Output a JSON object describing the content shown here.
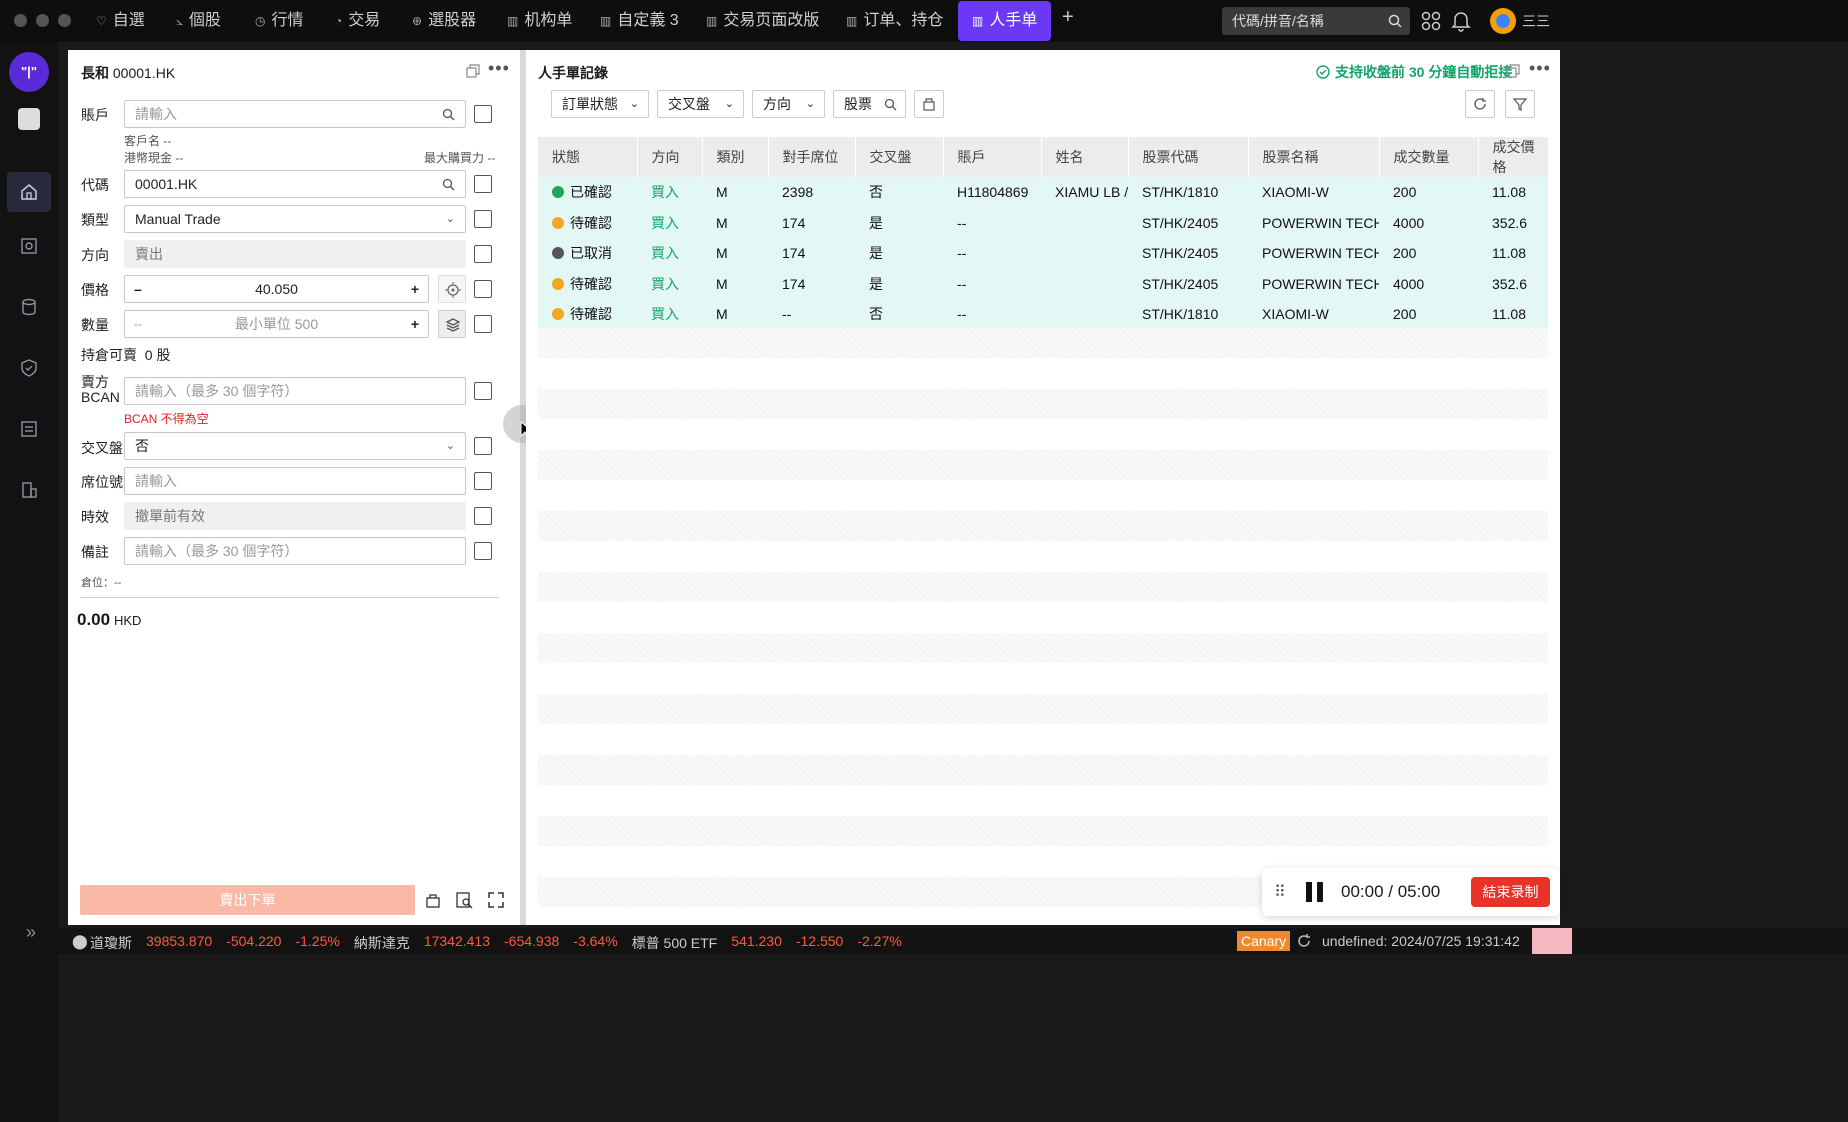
{
  "topbar": {
    "tabs": [
      {
        "icon": "heart-icon",
        "label": "自選"
      },
      {
        "icon": "chart-icon",
        "label": "個股"
      },
      {
        "icon": "quote-icon",
        "label": "行情"
      },
      {
        "icon": "pie-icon",
        "label": "交易"
      },
      {
        "icon": "crosshair-icon",
        "label": "選股器"
      },
      {
        "icon": "layout-icon",
        "label": "机构单"
      },
      {
        "icon": "layout-icon",
        "label": "自定義 3"
      },
      {
        "icon": "layout-icon",
        "label": "交易页面改版"
      },
      {
        "icon": "layout-icon",
        "label": "订单、持仓"
      },
      {
        "icon": "layout-icon",
        "label": "人手单"
      }
    ],
    "add_label": "+",
    "search_placeholder": "代碼/拼音/名稱",
    "user": "三三"
  },
  "left": {
    "title_name": "長和",
    "title_code": "00001.HK",
    "account_label": "賬戶",
    "account_placeholder": "請輸入",
    "client_name": "客戶名 --",
    "hkd_cash": "港幣現金 --",
    "max_buy": "最大購買力 --",
    "code_label": "代碼",
    "code_value": "00001.HK",
    "type_label": "類型",
    "type_value": "Manual Trade",
    "direction_label": "方向",
    "direction_value": "賣出",
    "price_label": "價格",
    "price_value": "40.050",
    "minus": "–",
    "plus": "+",
    "qty_label": "數量",
    "qty_placeholder": "最小單位 500",
    "qty_prefix": "--",
    "holdings_label": "持倉可賣",
    "holdings_value": "0 股",
    "seller_bcan_label": "賣方",
    "seller_bcan_label2": "BCAN",
    "bcan_placeholder": "請輸入（最多 30 個字符）",
    "bcan_error": "BCAN 不得為空",
    "cross_label": "交叉盤",
    "cross_value": "否",
    "seat_label": "席位號",
    "seat_placeholder": "請輸入",
    "validity_label": "時效",
    "validity_value": "撤單前有效",
    "remark_label": "備註",
    "remark_placeholder": "請輸入（最多 30 個字符）",
    "position": "倉位：--",
    "total_value": "0.00",
    "total_ccy": "HKD",
    "submit_label": "賣出下單"
  },
  "right": {
    "title": "人手單記錄",
    "notice": "支持收盤前 30 分鐘自動拒接",
    "filters": [
      "訂單狀態",
      "交叉盤",
      "方向"
    ],
    "stock_filter": "股票",
    "columns": [
      "狀態",
      "方向",
      "類別",
      "對手席位",
      "交叉盤",
      "賬戶",
      "姓名",
      "股票代碼",
      "股票名稱",
      "成交數量",
      "成交價格"
    ],
    "rows": [
      {
        "status": "已確認",
        "status_color": "#1fa55a",
        "dir": "買入",
        "cat": "M",
        "seat": "2398",
        "cross": "否",
        "acct": "H11804869",
        "name": "XIAMU LB / X",
        "code": "ST/HK/1810",
        "sname": "XIAOMI-W",
        "qty": "200",
        "price": "11.08"
      },
      {
        "status": "待確認",
        "status_color": "#f5a623",
        "dir": "買入",
        "cat": "M",
        "seat": "174",
        "cross": "是",
        "acct": "--",
        "name": "",
        "code": "ST/HK/2405",
        "sname": "POWERWIN TECH",
        "qty": "4000",
        "price": "352.6"
      },
      {
        "status": "已取消",
        "status_color": "#555555",
        "dir": "買入",
        "cat": "M",
        "seat": "174",
        "cross": "是",
        "acct": "--",
        "name": "",
        "code": "ST/HK/2405",
        "sname": "POWERWIN TECH",
        "qty": "200",
        "price": "11.08"
      },
      {
        "status": "待確認",
        "status_color": "#f5a623",
        "dir": "買入",
        "cat": "M",
        "seat": "174",
        "cross": "是",
        "acct": "--",
        "name": "",
        "code": "ST/HK/2405",
        "sname": "POWERWIN TECH",
        "qty": "4000",
        "price": "352.6"
      },
      {
        "status": "待確認",
        "status_color": "#f5a623",
        "dir": "買入",
        "cat": "M",
        "seat": "--",
        "cross": "否",
        "acct": "--",
        "name": "",
        "code": "ST/HK/1810",
        "sname": "XIAOMI-W",
        "qty": "200",
        "price": "11.08"
      }
    ]
  },
  "recorder": {
    "time": "00:00 / 05:00",
    "end_label": "結束录制"
  },
  "ticker": {
    "items": [
      {
        "name": "道瓊斯",
        "price": "39853.870",
        "chg": "-504.220",
        "pct": "-1.25%"
      },
      {
        "name": "納斯達克",
        "price": "17342.413",
        "chg": "-654.938",
        "pct": "-3.64%"
      },
      {
        "name": "標普 500 ETF",
        "price": "541.230",
        "chg": "-12.550",
        "pct": "-2.27%"
      }
    ],
    "canary": "Canary",
    "status": "undefined: 2024/07/25 19:31:42"
  }
}
